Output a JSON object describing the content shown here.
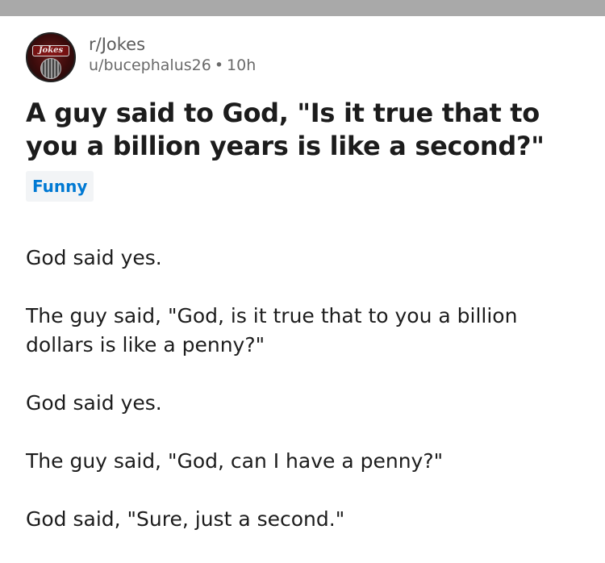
{
  "post": {
    "subreddit": "r/Jokes",
    "author": "u/bucephalus26",
    "separator": "•",
    "time": "10h",
    "avatar_text": "Jokes",
    "title": "A guy said to God, \"Is it true that to you a billion years is like a second?\"",
    "flair": "Funny",
    "flair_color": "#0079d3",
    "body": [
      "God said yes.",
      "The guy said, \"God, is it true that to you a billion dollars is like a penny?\"",
      "God said yes.",
      "The guy said, \"God, can I have a penny?\"",
      "God said, \"Sure, just a second.\""
    ]
  }
}
